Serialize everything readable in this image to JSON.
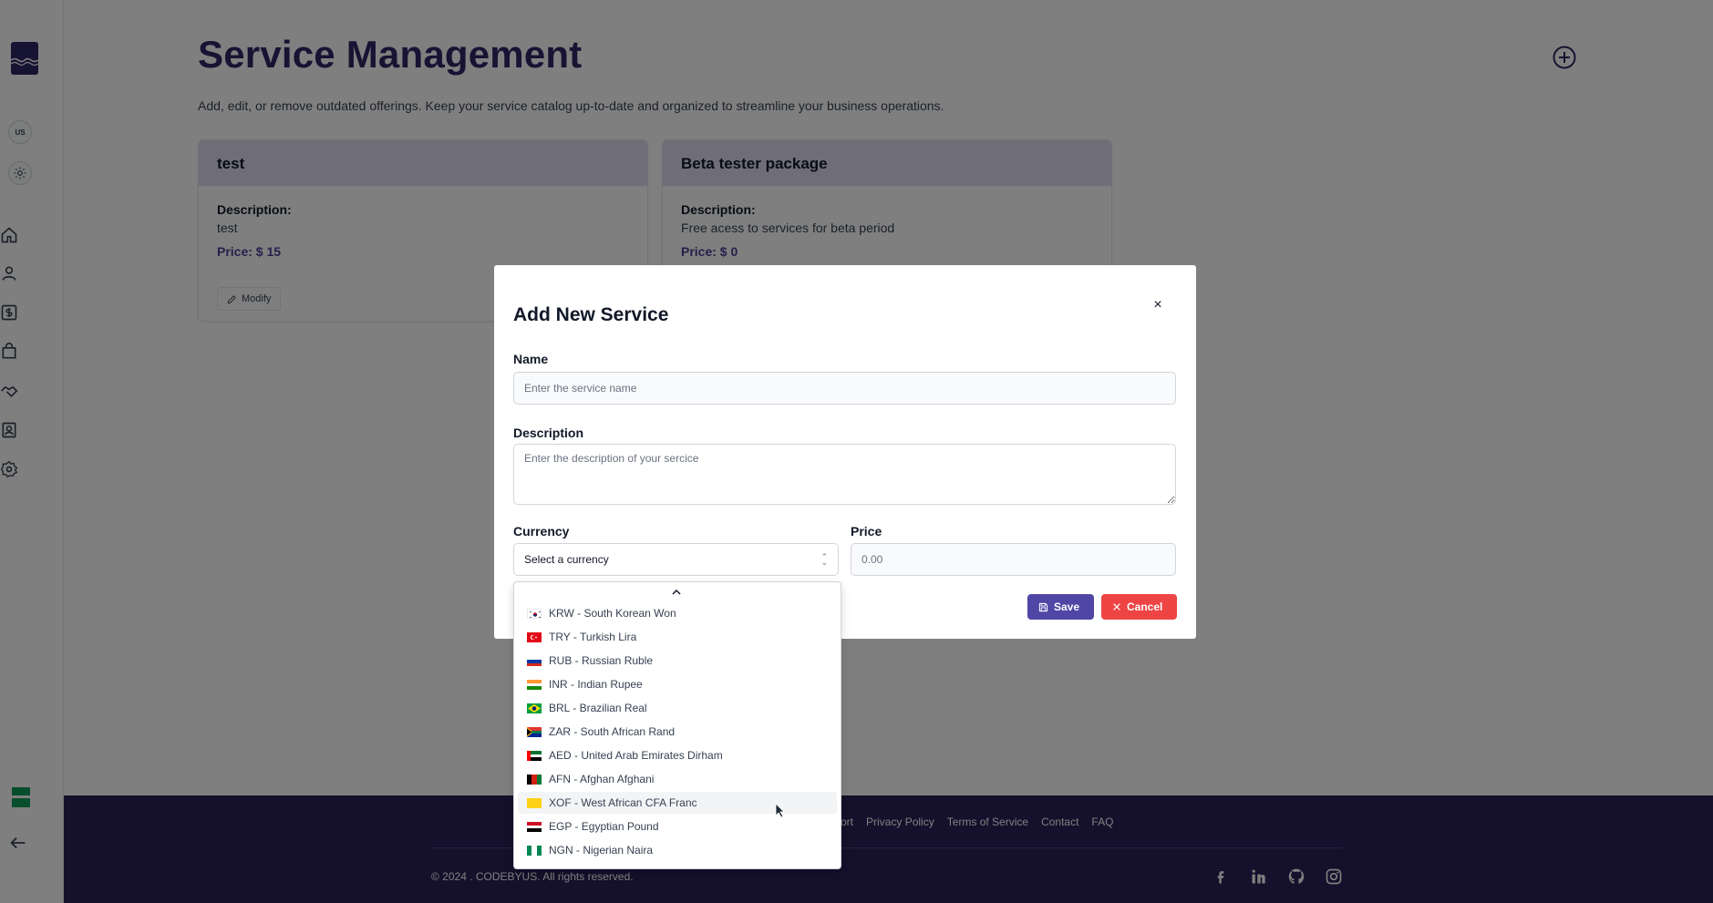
{
  "sidebar": {
    "language_badge": "US"
  },
  "page": {
    "title": "Service Management",
    "subtitle": "Add, edit, or remove outdated offerings. Keep your service catalog up-to-date and organized to streamline your business operations."
  },
  "services": [
    {
      "name": "test",
      "description_label": "Description:",
      "description": "test",
      "price": "Price: $ 15",
      "modify_label": "Modify"
    },
    {
      "name": "Beta tester package",
      "description_label": "Description:",
      "description": "Free acess to services for beta period",
      "price": "Price: $ 0"
    }
  ],
  "modal": {
    "title": "Add New Service",
    "close_glyph": "×",
    "name_label": "Name",
    "name_placeholder": "Enter the service name",
    "description_label": "Description",
    "description_placeholder": "Enter the description of your sercice",
    "currency_label": "Currency",
    "currency_placeholder": "Select a currency",
    "price_label": "Price",
    "price_placeholder": "0.00",
    "save_label": "Save",
    "cancel_label": "Cancel"
  },
  "currency_options": [
    {
      "label": "KRW - South Korean Won",
      "flag": "kr"
    },
    {
      "label": "TRY - Turkish Lira",
      "flag": "tr"
    },
    {
      "label": "RUB - Russian Ruble",
      "flag": "ru"
    },
    {
      "label": "INR - Indian Rupee",
      "flag": "in"
    },
    {
      "label": "BRL - Brazilian Real",
      "flag": "br"
    },
    {
      "label": "ZAR - South African Rand",
      "flag": "za"
    },
    {
      "label": "AED - United Arab Emirates Dirham",
      "flag": "ae"
    },
    {
      "label": "AFN - Afghan Afghani",
      "flag": "af"
    },
    {
      "label": "XOF - West African CFA Franc",
      "flag": "xof",
      "hovered": true
    },
    {
      "label": "EGP - Egyptian Pound",
      "flag": "eg"
    },
    {
      "label": "NGN - Nigerian Naira",
      "flag": "ng"
    }
  ],
  "footer": {
    "links": [
      "ort",
      "Privacy Policy",
      "Terms of Service",
      "Contact",
      "FAQ"
    ],
    "copyright": "© 2024 . CODEBYUS. All rights reserved."
  },
  "colors": {
    "brand": "#2e2766",
    "primary_button": "#4f46a5",
    "danger_button": "#ef4444",
    "card_header": "#dcdaf0",
    "footer_bg": "#2a2157"
  }
}
